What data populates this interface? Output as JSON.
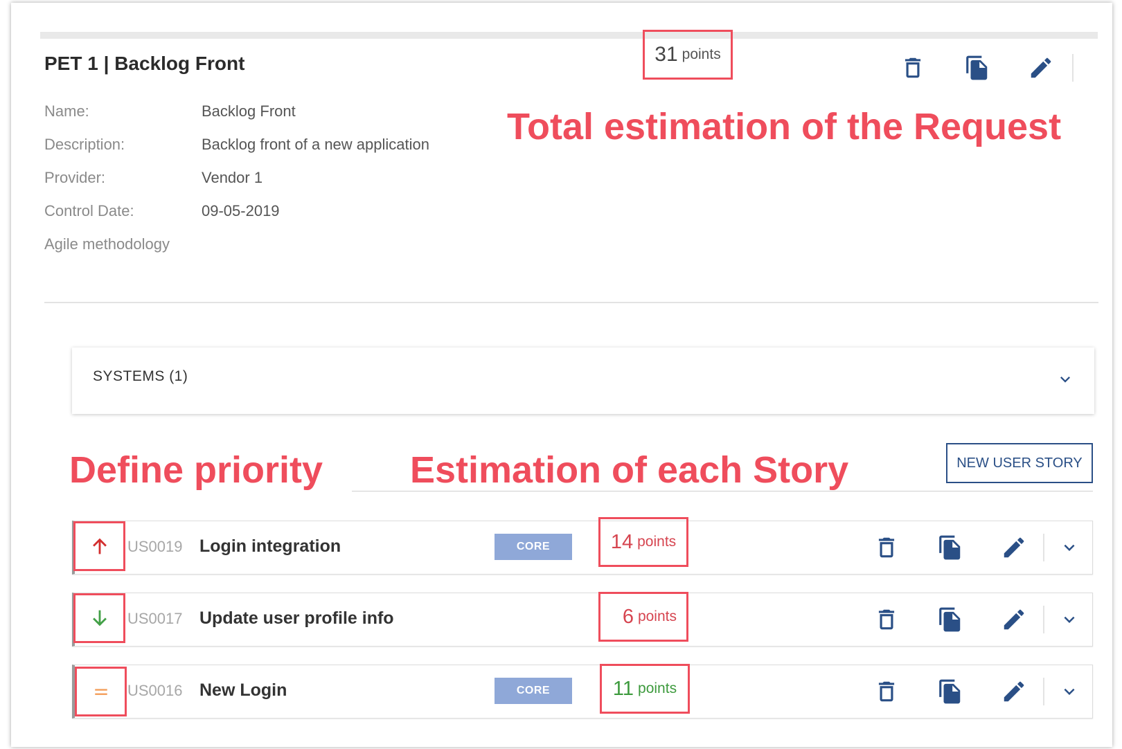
{
  "header": {
    "title": "PET 1 | Backlog Front",
    "total_points": {
      "value": "31",
      "unit": "points"
    }
  },
  "info": [
    {
      "label": "Name:",
      "value": "Backlog Front"
    },
    {
      "label": "Description:",
      "value": "Backlog front of a new application"
    },
    {
      "label": "Provider:",
      "value": "Vendor 1"
    },
    {
      "label": "Control Date:",
      "value": "09-05-2019"
    },
    {
      "label": "Agile methodology",
      "value": ""
    }
  ],
  "annotations": {
    "total": "Total estimation of the Request",
    "priority": "Define priority",
    "story_estimation": "Estimation of each Story"
  },
  "systems": {
    "label": "SYSTEMS (1)"
  },
  "new_story_button": "NEW USER STORY",
  "stories": [
    {
      "id": "US0019",
      "title": "Login integration",
      "badge": "CORE",
      "points": "14",
      "unit": "points",
      "priority": "high",
      "priority_icon": "arrow-up-icon",
      "points_color": "#d64550"
    },
    {
      "id": "US0017",
      "title": "Update user profile info",
      "badge": "",
      "points": "6",
      "unit": "points",
      "priority": "low",
      "priority_icon": "arrow-down-icon",
      "points_color": "#d64550"
    },
    {
      "id": "US0016",
      "title": "New Login",
      "badge": "CORE",
      "points": "11",
      "unit": "points",
      "priority": "medium",
      "priority_icon": "equals-icon",
      "points_color": "#3d9a3d"
    }
  ],
  "colors": {
    "primary": "#2a4f86",
    "annotation": "#ef4d5c",
    "priority_high": "#d32f2f",
    "priority_low": "#43a047",
    "priority_medium": "#f4a261",
    "badge": "#8fa8d8"
  }
}
